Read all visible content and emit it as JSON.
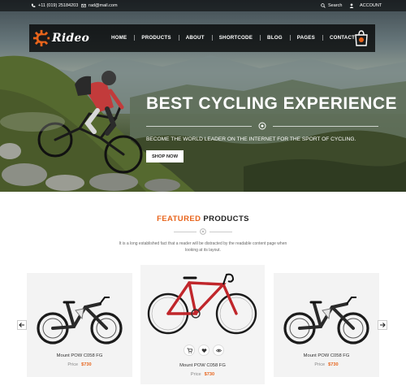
{
  "topbar": {
    "phone": "+11 (019) 25184203",
    "email": "rad@mail.com",
    "search_label": "Search",
    "account_label": "ACCOUNT"
  },
  "brand": {
    "logo_text": "Rideo"
  },
  "nav": {
    "items": [
      "HOME",
      "PRODUCTS",
      "ABOUT",
      "SHORTCODE",
      "BLOG",
      "PAGES",
      "CONTACT"
    ]
  },
  "hero": {
    "title": "BEST CYCLING EXPERIENCE",
    "subtitle": "BECOME THE WORLD LEADER ON THE INTERNET FOR THE SPORT OF CYCLING.",
    "cta_label": "SHOP NOW"
  },
  "featured": {
    "title_accent": "FEATURED",
    "title_rest": "PRODUCTS",
    "description": "It is a long established fact that a reader will be distracted by the readable content page when looking at its layout.",
    "products": [
      {
        "name": "Mount POW C058 FG",
        "price_label": "Price",
        "price": "$730"
      },
      {
        "name": "Mount POW C058 FG",
        "price_label": "Price",
        "price": "$730"
      },
      {
        "name": "Mount POW C058 FG",
        "price_label": "Price",
        "price": "$730"
      }
    ]
  },
  "colors": {
    "accent": "#e8641b",
    "nav_bg": "#111111",
    "road_bike_frame": "#c0262b"
  },
  "icons": [
    "phone-icon",
    "mail-icon",
    "search-icon",
    "user-icon",
    "gear-logo-icon",
    "cart-icon",
    "gear-divider-icon",
    "add-to-cart-icon",
    "wishlist-icon",
    "quick-view-icon",
    "arrow-left-icon",
    "arrow-right-icon"
  ]
}
